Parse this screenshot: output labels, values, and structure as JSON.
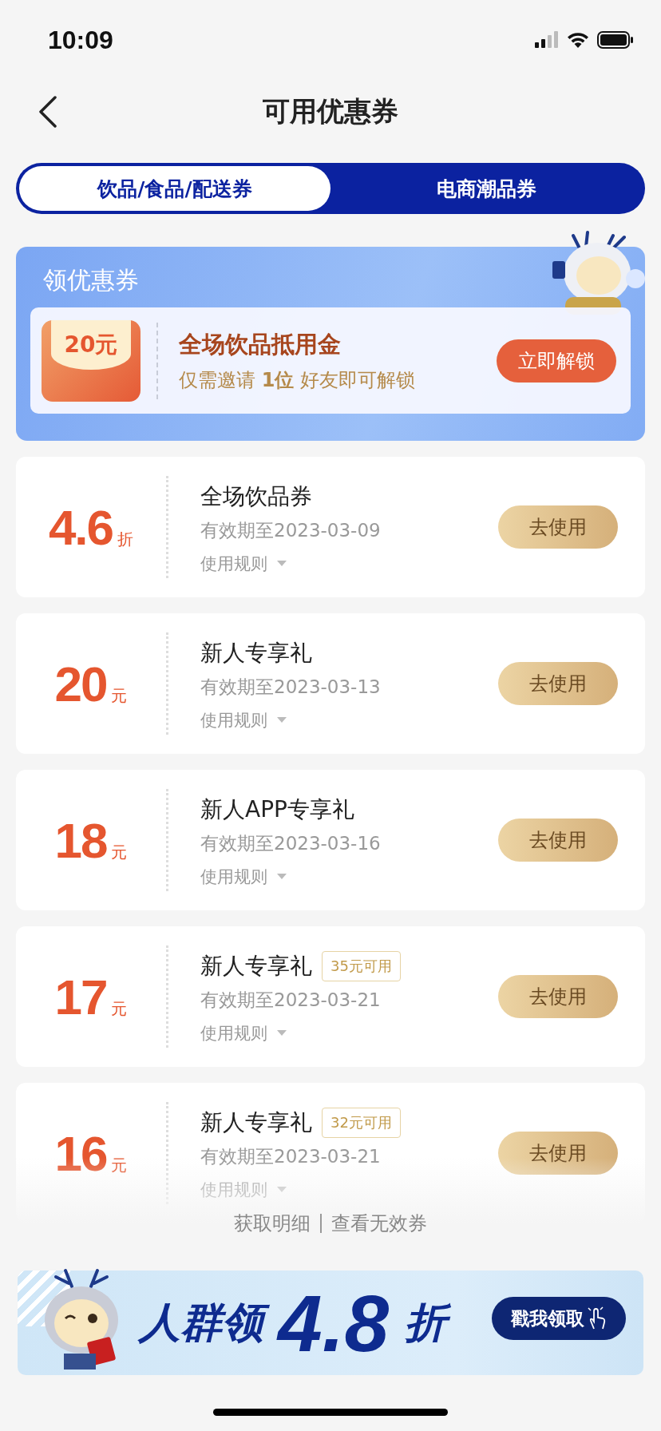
{
  "status_bar": {
    "time": "10:09"
  },
  "nav": {
    "title": "可用优惠券"
  },
  "tabs": [
    {
      "label": "饮品/食品/配送券",
      "selected": true
    },
    {
      "label": "电商潮品券",
      "selected": false
    }
  ],
  "promo": {
    "heading": "领优惠券",
    "voucher_value": "20元",
    "title": "全场饮品抵用金",
    "subtitle": "仅需邀请 **1位** 好友即可解锁",
    "button": "立即解锁"
  },
  "coupons": [
    {
      "amount": "4.6",
      "unit": "折",
      "name": "全场饮品券",
      "validity": "有效期至2023-03-09",
      "rules": "使用规则",
      "button": "去使用"
    },
    {
      "amount": "20",
      "unit": "元",
      "name": "新人专享礼",
      "validity": "有效期至2023-03-13",
      "rules": "使用规则",
      "button": "去使用"
    },
    {
      "amount": "18",
      "unit": "元",
      "name": "新人APP专享礼",
      "validity": "有效期至2023-03-16",
      "rules": "使用规则",
      "button": "去使用"
    },
    {
      "amount": "17",
      "unit": "元",
      "name": "新人专享礼",
      "tag": "35元可用",
      "validity": "有效期至2023-03-21",
      "rules": "使用规则",
      "button": "去使用"
    },
    {
      "amount": "16",
      "unit": "元",
      "name": "新人专享礼",
      "tag": "32元可用",
      "validity": "有效期至2023-03-21",
      "rules": "使用规则",
      "button": "去使用"
    }
  ],
  "links": [
    "获取明细",
    "查看无效券"
  ],
  "banner": {
    "lead": "人群领",
    "rate": "4.8",
    "unit": "折",
    "button": "戳我领取"
  }
}
